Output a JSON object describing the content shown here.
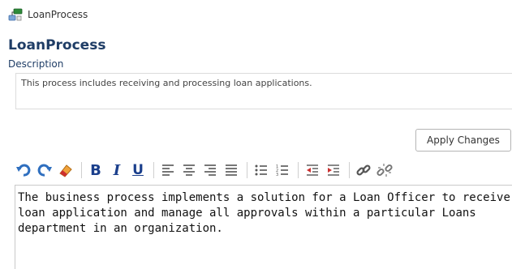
{
  "breadcrumb": {
    "icon": "process-icon",
    "label": "LoanProcess"
  },
  "title": "LoanProcess",
  "description": {
    "label": "Description",
    "text": "This process includes receiving and processing loan applications."
  },
  "apply_button": {
    "label": "Apply Changes"
  },
  "toolbar": {
    "undo_icon": "undo-icon",
    "redo_icon": "redo-icon",
    "eraser_icon": "eraser-icon",
    "bold": "B",
    "italic": "I",
    "underline": "U",
    "align_icons": [
      "align-left-icon",
      "align-center-icon",
      "align-right-icon",
      "align-justify-icon"
    ],
    "list_icons": [
      "bullet-list-icon",
      "numbered-list-icon"
    ],
    "indent_icons": [
      "outdent-icon",
      "indent-icon"
    ],
    "link_icons": [
      "link-icon",
      "unlink-icon"
    ]
  },
  "editor": {
    "lines": [
      "The business process implements a solution for a Loan Officer to receive a",
      "loan application and manage all approvals within a particular Loans",
      "department in an organization."
    ]
  },
  "colors": {
    "title": "#1f3d66",
    "toolbar_blue": "#1b3f8c"
  }
}
